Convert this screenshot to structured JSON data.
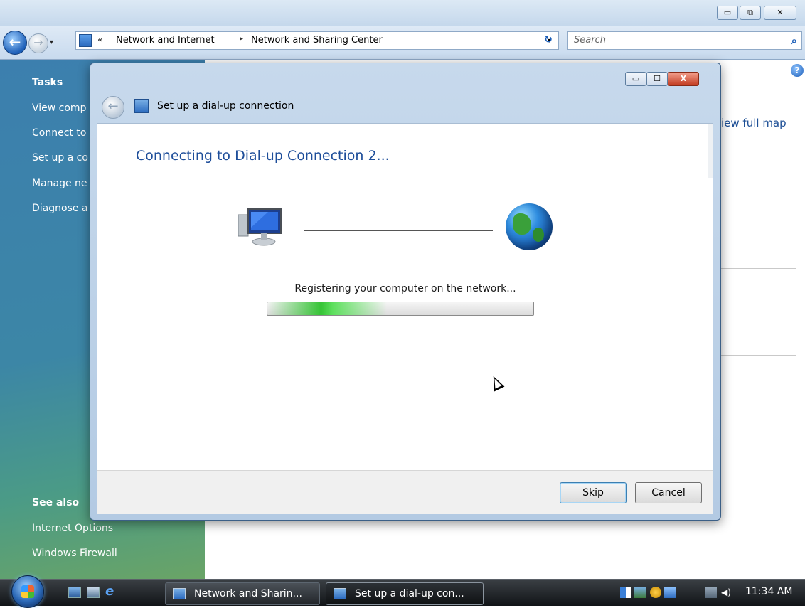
{
  "window": {
    "minimize": "▭",
    "restore": "⧉",
    "close": "✕"
  },
  "address_bar": {
    "chevron": "«",
    "crumbs": [
      "Network and Internet",
      "Network and Sharing Center"
    ],
    "separator": "▸",
    "dropdown": "▾",
    "refresh": "↻",
    "search_placeholder": "Search",
    "search_icon": "⌕"
  },
  "sidebar": {
    "tasks_title": "Tasks",
    "tasks": [
      "View comp",
      "Connect to",
      "Set up a co",
      "Manage ne",
      "Diagnose a"
    ],
    "see_also_title": "See also",
    "see_also": [
      "Internet Options",
      "Windows Firewall"
    ]
  },
  "content": {
    "view_full_map": "iew full map",
    "help": "?"
  },
  "dialog": {
    "title": "Set up a dial-up connection",
    "minimize": "▭",
    "maximize": "☐",
    "close": "X",
    "back_arrow": "←",
    "heading": "Connecting to Dial-up Connection 2...",
    "status": "Registering your computer on the network...",
    "progress_fraction": 0.45,
    "skip_label": "Skip",
    "cancel_label": "Cancel"
  },
  "taskbar": {
    "tasks": [
      "Network and Sharin...",
      "Set up a dial-up con..."
    ],
    "clock": "11:34 AM"
  },
  "colors": {
    "sidebar": "#3c7fae",
    "heading": "#1e4e9a",
    "progress": "#36c436",
    "dialog_close": "#c23b20"
  }
}
